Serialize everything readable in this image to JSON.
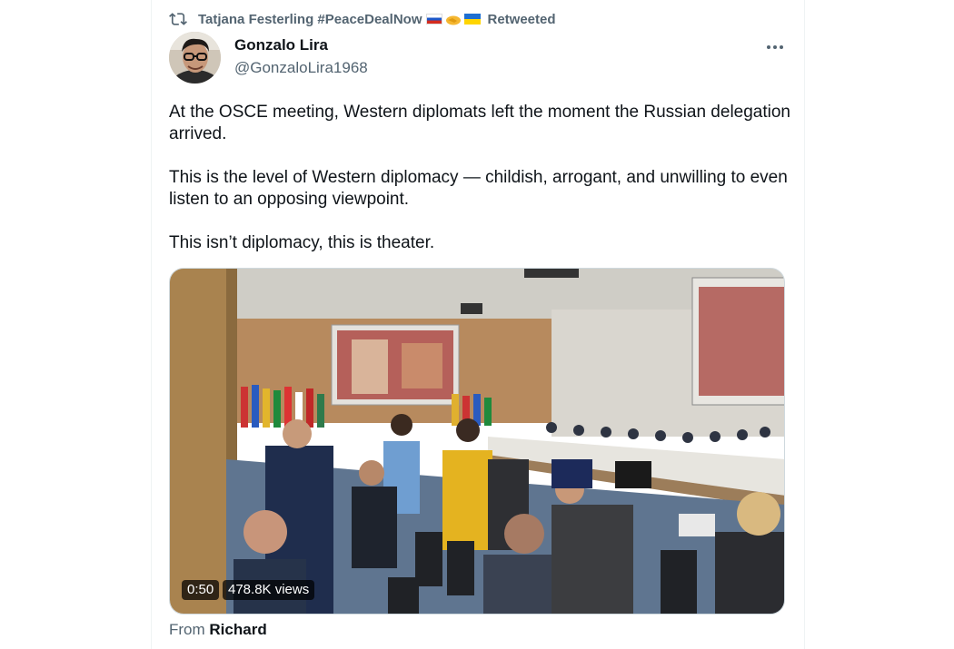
{
  "retweet": {
    "icon": "retweet-icon",
    "user": "Tatjana Festerling #PeaceDealNow",
    "emoji": [
      "flag-russia",
      "handshake",
      "flag-ukraine"
    ],
    "label": "Retweeted"
  },
  "author": {
    "name": "Gonzalo Lira",
    "handle": "@GonzaloLira1968",
    "avatar": "author-avatar"
  },
  "more_icon": "more-horizontal-icon",
  "tweet": {
    "paragraphs": [
      "At the OSCE meeting, Western diplomats left the moment the Russian delegation arrived.",
      "This is the level of Western diplomacy — childish, arrogant, and unwilling to even listen to an opposing viewpoint.",
      "This isn’t diplomacy, this is theater."
    ]
  },
  "media": {
    "type": "video",
    "duration": "0:50",
    "views": "478.8K views"
  },
  "source": {
    "prefix": "From",
    "name": "Richard"
  },
  "colors": {
    "text_primary": "#0f1419",
    "text_secondary": "#536471",
    "border": "#eff3f4"
  }
}
